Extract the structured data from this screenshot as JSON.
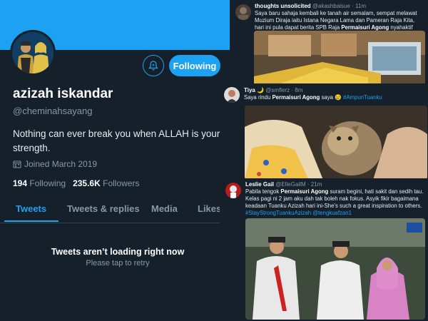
{
  "profile": {
    "name": "azizah iskandar",
    "handle": "@cheminahsayang",
    "bio": "Nothing can ever break you when ALLAH is your strength.",
    "joined": "Joined March 2019",
    "following_count": "194",
    "following_label": "Following",
    "followers_count": "235.6K",
    "followers_label": "Followers",
    "follow_button": "Following",
    "tabs": [
      "Tweets",
      "Tweets & replies",
      "Media",
      "Likes"
    ],
    "empty_title": "Tweets aren’t loading right now",
    "empty_sub": "Please tap to retry"
  },
  "tweets": [
    {
      "name": "thoughts unsolicited",
      "handle": "@akashbaisue",
      "time": "· 11m",
      "text_pre": "Saya baru sahaja kembali ke tanah air semalam, sempat melawat Muzium Diraja iaitu Istana Negara Lama dan Pameran Raja Kita, hari ini pula dapat berita SPB Raja ",
      "text_bold": "Permaisuri Agong",
      "text_post": " nyahaktif akaun Twitter."
    },
    {
      "name": "Tiya 🌙",
      "handle": "@smflerz",
      "time": "· 8m",
      "text_pre": "Saya rindu ",
      "text_bold": "Permaisuri Agong",
      "text_post": " saya 😢 ",
      "tags": "#AmpunTuanku"
    },
    {
      "name": "Leslie Gail",
      "handle": "@ElleGailM",
      "time": "· 21m",
      "text_pre": "Pabila tengok ",
      "text_bold": "Permaisuri Agong",
      "text_post": " suram begini, hati sakit dan sedih tau. Kelas pagi ni 2 jam aku dah tak boleh nak fokus. Asyik fikir bagaimana keadaan Tuanku Azizah hari ini-She’s such a great inspiration to others. ",
      "tags": "#StayStrongTuankuAzizah @tengkuafzan1"
    }
  ],
  "colors": {
    "bg": "#15202b",
    "accent": "#1da1f2",
    "muted": "#8899a6"
  },
  "icons": [
    "bell-icon",
    "calendar-icon"
  ]
}
